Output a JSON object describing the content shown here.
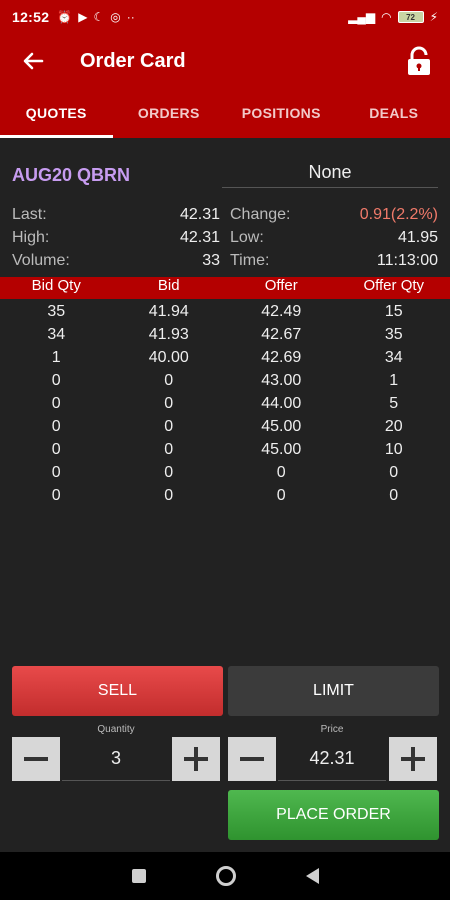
{
  "status": {
    "time": "12:52",
    "battery": "72"
  },
  "header": {
    "title": "Order Card"
  },
  "tabs": [
    {
      "label": "QUOTES",
      "active": true
    },
    {
      "label": "ORDERS",
      "active": false
    },
    {
      "label": "POSITIONS",
      "active": false
    },
    {
      "label": "DEALS",
      "active": false
    }
  ],
  "instrument": {
    "symbol": "AUG20 QBRN",
    "account": "None"
  },
  "stats": {
    "last_label": "Last:",
    "last": "42.31",
    "change_label": "Change:",
    "change": "0.91(2.2%)",
    "high_label": "High:",
    "high": "42.31",
    "low_label": "Low:",
    "low": "41.95",
    "volume_label": "Volume:",
    "volume": "33",
    "time_label": "Time:",
    "time": "11:13:00"
  },
  "book": {
    "headers": [
      "Bid Qty",
      "Bid",
      "Offer",
      "Offer Qty"
    ],
    "rows": [
      [
        "35",
        "41.94",
        "42.49",
        "15"
      ],
      [
        "34",
        "41.93",
        "42.67",
        "35"
      ],
      [
        "1",
        "40.00",
        "42.69",
        "34"
      ],
      [
        "0",
        "0",
        "43.00",
        "1"
      ],
      [
        "0",
        "0",
        "44.00",
        "5"
      ],
      [
        "0",
        "0",
        "45.00",
        "20"
      ],
      [
        "0",
        "0",
        "45.00",
        "10"
      ],
      [
        "0",
        "0",
        "0",
        "0"
      ],
      [
        "0",
        "0",
        "0",
        "0"
      ]
    ]
  },
  "order": {
    "side": "SELL",
    "type": "LIMIT",
    "quantity_label": "Quantity",
    "quantity": "3",
    "price_label": "Price",
    "price": "42.31",
    "place_label": "PLACE ORDER"
  },
  "colors": {
    "brand": "#b40000",
    "sell": "#d63a3a",
    "place": "#3fa53f",
    "symbol": "#c79cf0",
    "change_up": "#f07a6a"
  }
}
